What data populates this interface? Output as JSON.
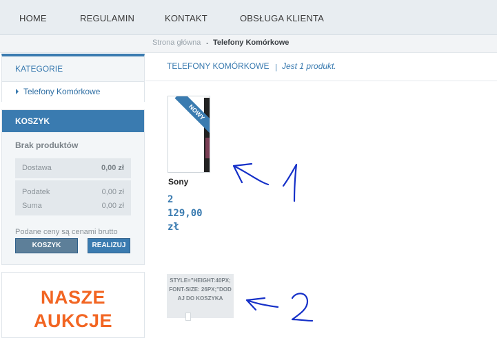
{
  "nav": {
    "items": [
      "HOME",
      "REGULAMIN",
      "KONTAKT",
      "OBSŁUGA KLIENTA"
    ]
  },
  "breadcrumb": {
    "home": "Strona główna",
    "separator": ".",
    "current": "Telefony Komórkowe"
  },
  "categories": {
    "title": "KATEGORIE",
    "items": [
      {
        "label": "Telefony Komórkowe"
      }
    ]
  },
  "cart": {
    "title": "KOSZYK",
    "empty_text": "Brak produktów",
    "rows": [
      {
        "label": "Dostawa",
        "value": "0,00 zł"
      },
      {
        "label": "Podatek",
        "value": "0,00 zł"
      },
      {
        "label": "Suma",
        "value": "0,00 zł"
      }
    ],
    "price_note": "Podane ceny są cenami brutto",
    "cart_button": "KOSZYK",
    "checkout_button": "REALIZUJ"
  },
  "auction": {
    "line1": "NASZE",
    "line2": "AUKCJE"
  },
  "main": {
    "title": "TELEFONY KOMÓRKOWE",
    "divider": "|",
    "count": "Jest 1 produkt."
  },
  "product": {
    "badge": "NOWY",
    "name": "Sony",
    "price_line1": "2",
    "price_line2": "129,00",
    "price_line3": "zł",
    "broken_button_text": "STYLE=\"HEIGHT:40PX; FONT-SIZE: 26PX;\"DODAJ DO KOSZYKA"
  },
  "colors": {
    "accent": "#3a7bb0",
    "orange": "#f26522",
    "annotation": "#1530c8"
  }
}
